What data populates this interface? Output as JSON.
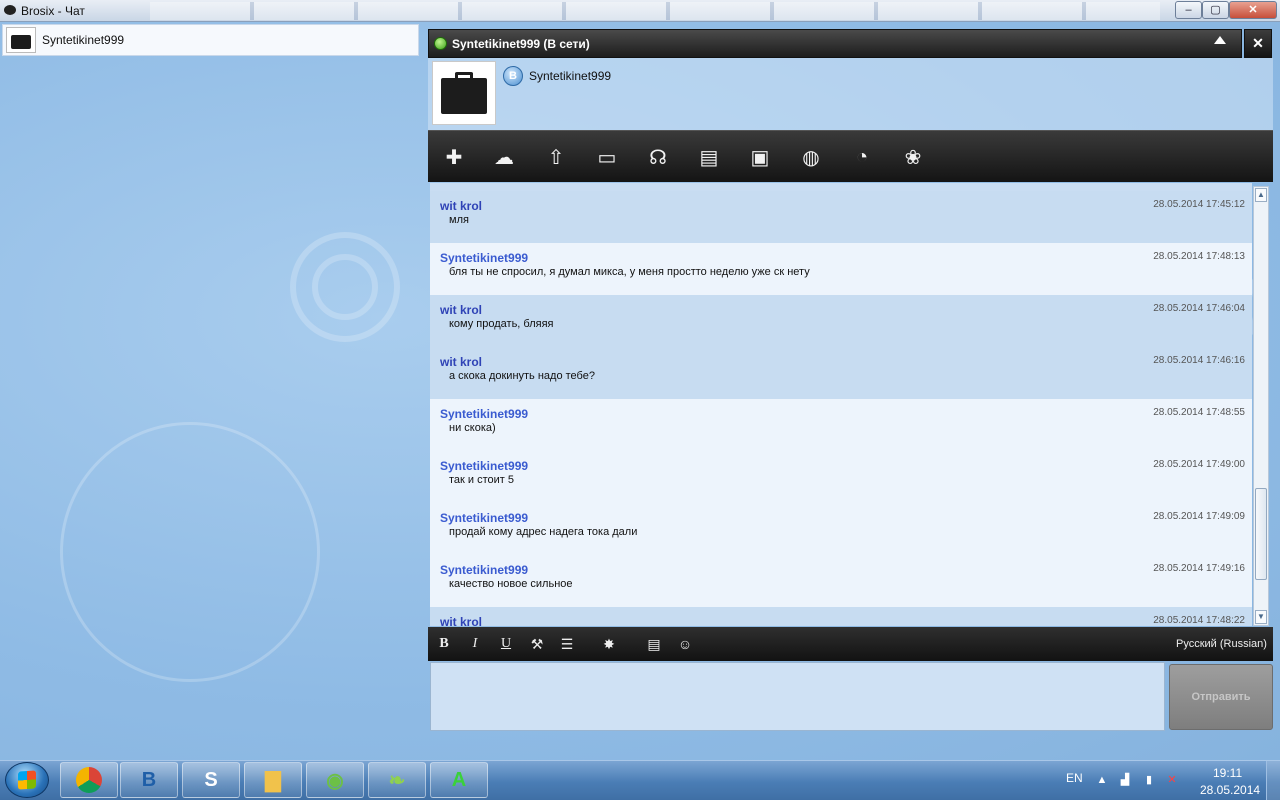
{
  "window": {
    "title": "Brosix - Чат",
    "minimize_label": "–",
    "maximize_label": "▢",
    "close_label": "✕"
  },
  "contacts": [
    {
      "name": "Syntetikinet999"
    }
  ],
  "chat": {
    "header_title": "Syntetikinet999 (В сети)",
    "close_label": "✕",
    "profile_name": "Syntetikinet999",
    "profile_badge": "B",
    "toolbar_icons": [
      "add-contact-icon",
      "group-chat-icon",
      "file-upload-icon",
      "screen-share-icon",
      "support-headset-icon",
      "remote-desktop-icon",
      "whiteboard-icon",
      "web-browser-icon",
      "history-icon",
      "group-icon"
    ],
    "messages": [
      {
        "sender": "wit krol",
        "text": "мля",
        "time": "28.05.2014 17:45:12",
        "mine": false
      },
      {
        "sender": "Syntetikinet999",
        "text": "бля ты не спросил, я думал микса, у меня простто неделю уже ск нету",
        "time": "28.05.2014 17:48:13",
        "mine": true
      },
      {
        "sender": "wit krol",
        "text": "кому продать, бляяя",
        "time": "28.05.2014 17:46:04",
        "mine": false
      },
      {
        "sender": "wit krol",
        "text": "а скока докинуть надо тебе?",
        "time": "28.05.2014 17:46:16",
        "mine": false
      },
      {
        "sender": "Syntetikinet999",
        "text": "ни скока)",
        "time": "28.05.2014 17:48:55",
        "mine": true
      },
      {
        "sender": "Syntetikinet999",
        "text": "так и стоит 5",
        "time": "28.05.2014 17:49:00",
        "mine": true
      },
      {
        "sender": "Syntetikinet999",
        "text": "продай кому адрес надега тока дали",
        "time": "28.05.2014 17:49:09",
        "mine": true
      },
      {
        "sender": "Syntetikinet999",
        "text": "качество новое сильное",
        "time": "28.05.2014 17:49:16",
        "mine": true
      },
      {
        "sender": "wit krol",
        "text": "",
        "time": "28.05.2014 17:48:22",
        "mine": false
      }
    ],
    "format": {
      "bold": "B",
      "italic": "I",
      "underline": "U",
      "language": "Русский (Russian)"
    },
    "send_label": "Отправить"
  },
  "taskbar": {
    "apps": [
      "chrome",
      "brosix",
      "skype",
      "file-explorer",
      "utorrent-like",
      "leaf-app",
      "green-a-app"
    ],
    "language": "EN",
    "time": "19:11",
    "date": "28.05.2014"
  }
}
